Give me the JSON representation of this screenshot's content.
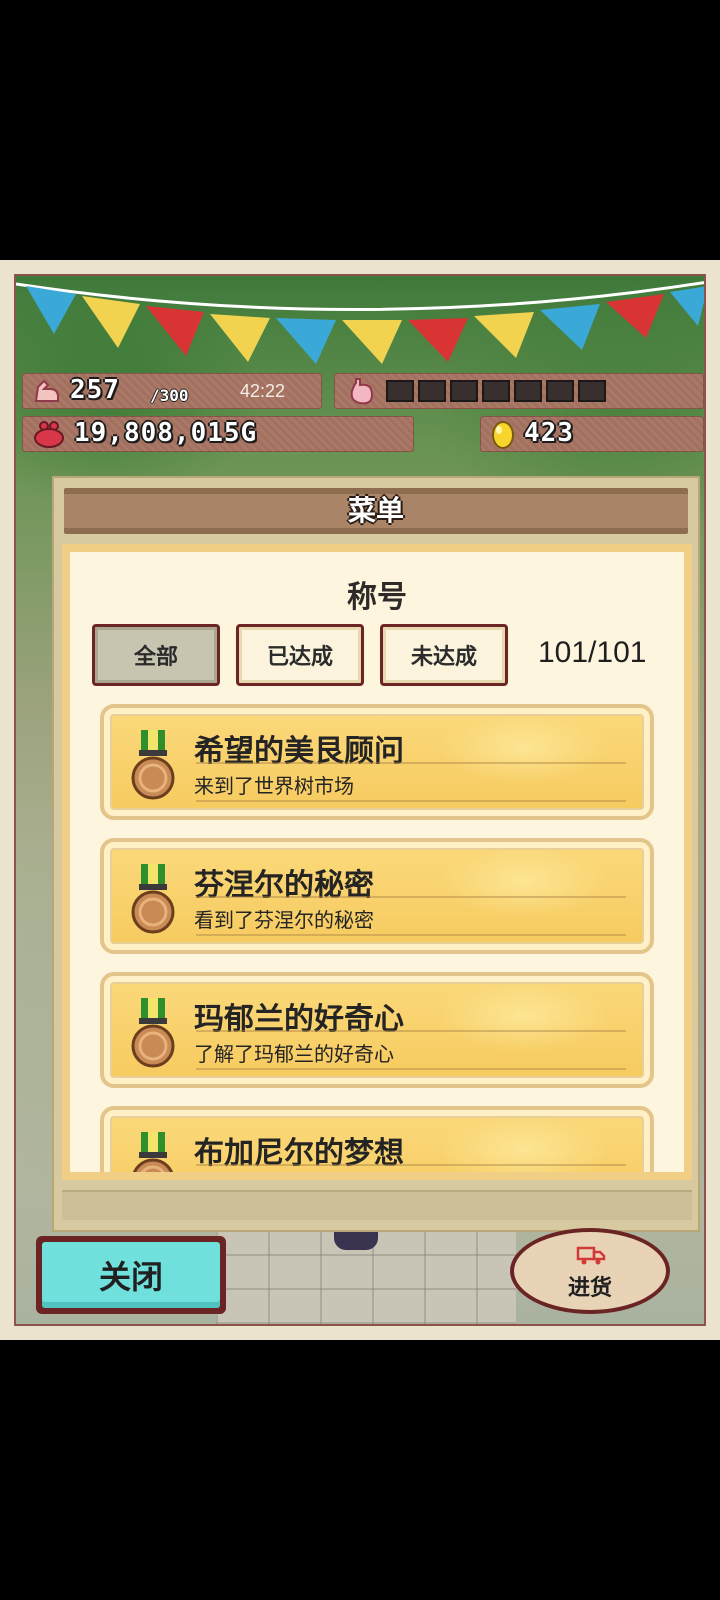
{
  "hud": {
    "stamina_current": "257",
    "stamina_max": "/300",
    "timer": "42:22",
    "hunger_filled_cells": 0,
    "hunger_total_cells": 7,
    "gold": "19,808,015G",
    "eggs": "423"
  },
  "menu": {
    "title": "菜单",
    "section_title": "称号",
    "filters": [
      {
        "label": "全部",
        "active": true
      },
      {
        "label": "已达成",
        "active": false
      },
      {
        "label": "未达成",
        "active": false
      }
    ],
    "count": "101/101",
    "titles": [
      {
        "name": "希望的美艮顾问",
        "desc": "来到了世界树市场"
      },
      {
        "name": "芬涅尔的秘密",
        "desc": "看到了芬涅尔的秘密"
      },
      {
        "name": "玛郁兰的好奇心",
        "desc": "了解了玛郁兰的好奇心"
      },
      {
        "name": "布加尼尔的梦想",
        "desc": ""
      }
    ]
  },
  "buttons": {
    "close": "关闭",
    "stock": "进货"
  },
  "colors": {
    "close_button": "#6fe0dc",
    "card": "#f6ca5e",
    "border": "#6b2424"
  }
}
